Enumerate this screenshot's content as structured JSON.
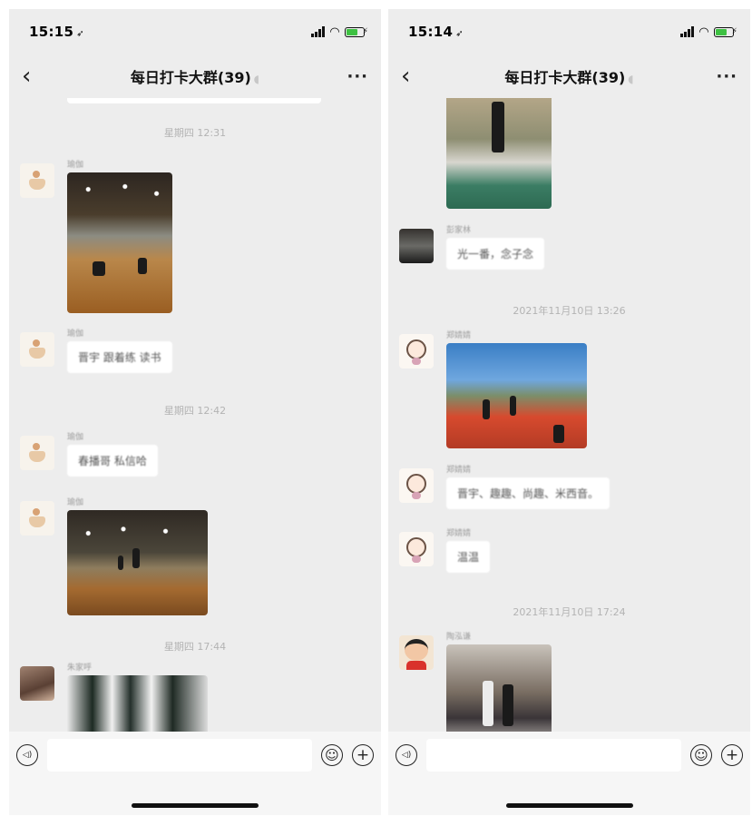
{
  "left_screen": {
    "status": {
      "time": "15:15",
      "location_glyph": "➶"
    },
    "nav": {
      "title": "每日打卡大群(39)"
    },
    "messages": [
      {
        "timestamp": "星期四 12:31"
      },
      {
        "sender": "瑜伽",
        "type": "photo"
      },
      {
        "sender": "瑜伽",
        "text": "晋宇 跟着练 读书"
      },
      {
        "timestamp": "星期四 12:42"
      },
      {
        "sender": "瑜伽",
        "text": "春播哥 私信哈"
      },
      {
        "sender": "瑜伽",
        "type": "photo"
      },
      {
        "timestamp": "星期四 17:44"
      },
      {
        "sender": "朱家呼",
        "type": "photo"
      }
    ]
  },
  "right_screen": {
    "status": {
      "time": "15:14",
      "location_glyph": "➶"
    },
    "nav": {
      "title": "每日打卡大群(39)"
    },
    "messages": [
      {
        "sender": "",
        "type": "photo"
      },
      {
        "sender": "彭家林",
        "text": "光一番，念子念"
      },
      {
        "timestamp": "2021年11月10日 13:26"
      },
      {
        "sender": "郑婧婧",
        "type": "photo"
      },
      {
        "sender": "郑婧婧",
        "text": "晋宇、趣趣、尚趣、米西音。"
      },
      {
        "sender": "郑婧婧",
        "text": "温温"
      },
      {
        "timestamp": "2021年11月10日 17:24"
      },
      {
        "sender": "陶泓谦",
        "type": "photo"
      }
    ]
  },
  "icons": {
    "back": "‹",
    "more": "···",
    "voice": "◁)",
    "emoji": "☺",
    "add": "+"
  },
  "colors": {
    "chat_background": "#ededed",
    "bubble": "#ffffff",
    "battery": "#3ec142"
  }
}
